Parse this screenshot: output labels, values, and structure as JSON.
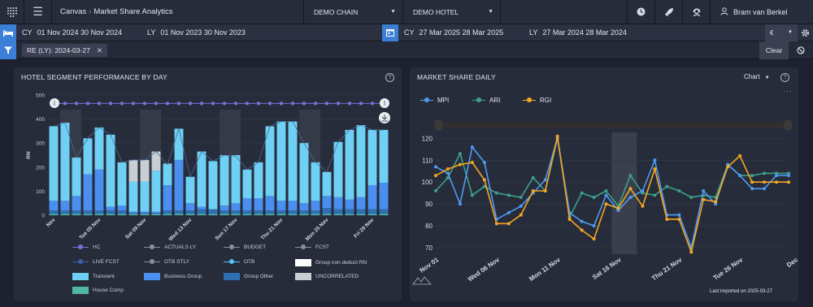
{
  "topbar": {
    "crumb_root": "Canvas",
    "crumb_page": "Market Share Analytics",
    "chain": "DEMO CHAIN",
    "hotel": "DEMO HOTEL",
    "user": "Bram van Berkel"
  },
  "dates": {
    "set1_cy_label": "CY",
    "set1_cy": "01 Nov 2024  30 Nov 2024",
    "set1_ly_label": "LY",
    "set1_ly": "01 Nov 2023  30 Nov 2023",
    "set2_cy_label": "CY",
    "set2_cy": "27 Mar 2025  28 Mar 2025",
    "set2_ly_label": "LY",
    "set2_ly": "27 Mar 2024  28 Mar 2024",
    "currency": "€"
  },
  "filters": {
    "chip": "RE (LY): 2024-03-27",
    "clear_label": "Clear"
  },
  "panel_left": {
    "title": "HOTEL SEGMENT PERFORMANCE BY DAY",
    "legend": [
      {
        "label": "HC",
        "kind": "line",
        "color": "#7b6fd6"
      },
      {
        "label": "ACTUALS LY",
        "kind": "line",
        "color": "#8a8f9c"
      },
      {
        "label": "BUDGET",
        "kind": "line",
        "color": "#8a8f9c"
      },
      {
        "label": "FCST",
        "kind": "line",
        "color": "#8a8f9c"
      },
      {
        "label": "LIVE FCST",
        "kind": "line",
        "color": "#3c5fa8"
      },
      {
        "label": "OTB STLY",
        "kind": "line",
        "color": "#8a8f9c"
      },
      {
        "label": "OTB",
        "kind": "line",
        "color": "#59c3f0"
      },
      {
        "label": "Group non deduct RN",
        "kind": "swatch",
        "color": "#ffffff"
      },
      {
        "label": "Transient",
        "kind": "swatch",
        "color": "#6fd0f5"
      },
      {
        "label": "Business Group",
        "kind": "swatch",
        "color": "#4a8ff0"
      },
      {
        "label": "Group Other",
        "kind": "swatch",
        "color": "#2f6fb0"
      },
      {
        "label": "UNCORRELATED",
        "kind": "swatch",
        "color": "#c9cdd4"
      },
      {
        "label": "House Comp",
        "kind": "swatch",
        "color": "#4fb8a5"
      }
    ]
  },
  "panel_right": {
    "title": "MARKET SHARE DAILY",
    "view_select": "Chart",
    "footer": "Last imported on 2025-03-27",
    "legend": [
      {
        "label": "MPI",
        "color": "#4d9bf0"
      },
      {
        "label": "ARI",
        "color": "#3fa08a"
      },
      {
        "label": "RGI",
        "color": "#f5a623"
      }
    ]
  },
  "chart_data": [
    {
      "type": "bar",
      "title": "HOTEL SEGMENT PERFORMANCE BY DAY",
      "ylabel": "RN",
      "ylim": [
        0,
        500
      ],
      "yticks": [
        0,
        100,
        200,
        300,
        400,
        500
      ],
      "categories": [
        "Nov",
        "2",
        "3",
        "4",
        "Tue 05 Nov",
        "6",
        "7",
        "8",
        "Sat 09 Nov",
        "10",
        "11",
        "12",
        "Wed 13 Nov",
        "14",
        "15",
        "16",
        "Sun 17 Nov",
        "18",
        "19",
        "20",
        "Thu 21 Nov",
        "22",
        "23",
        "24",
        "Mon 25 Nov",
        "26",
        "27",
        "28",
        "Fri 29 Nov",
        "30"
      ],
      "x_tick_labels": [
        "Nov",
        "Tue 05 Nov",
        "Sat 09 Nov",
        "Wed 13 Nov",
        "Sun 17 Nov",
        "Thu 21 Nov",
        "Mon 25 Nov",
        "Fri 29 Nov"
      ],
      "series": [
        {
          "name": "Transient",
          "values": [
            310,
            325,
            160,
            150,
            175,
            300,
            180,
            125,
            125,
            170,
            90,
            130,
            110,
            230,
            200,
            210,
            200,
            120,
            150,
            290,
            330,
            330,
            250,
            160,
            100,
            230,
            290,
            300,
            230,
            220
          ]
        },
        {
          "name": "Business Group",
          "values": [
            40,
            40,
            60,
            150,
            170,
            15,
            20,
            5,
            5,
            5,
            105,
            210,
            30,
            10,
            0,
            20,
            30,
            50,
            50,
            60,
            40,
            40,
            30,
            40,
            50,
            50,
            40,
            50,
            100,
            110
          ]
        },
        {
          "name": "Group Other",
          "values": [
            15,
            15,
            15,
            15,
            15,
            15,
            15,
            5,
            5,
            5,
            15,
            15,
            15,
            20,
            20,
            15,
            15,
            15,
            15,
            15,
            15,
            15,
            15,
            15,
            25,
            20,
            20,
            20,
            20,
            20
          ]
        },
        {
          "name": "UNCORRELATED",
          "values": [
            0,
            0,
            0,
            0,
            0,
            0,
            0,
            90,
            90,
            80,
            0,
            0,
            0,
            0,
            0,
            0,
            0,
            0,
            0,
            0,
            0,
            0,
            0,
            0,
            0,
            0,
            0,
            0,
            0,
            0
          ]
        },
        {
          "name": "House Comp",
          "values": [
            5,
            5,
            5,
            5,
            5,
            5,
            5,
            5,
            5,
            5,
            5,
            5,
            5,
            5,
            5,
            5,
            5,
            5,
            5,
            5,
            5,
            5,
            5,
            5,
            5,
            5,
            5,
            5,
            5,
            5
          ]
        },
        {
          "name": "HC",
          "values": [
            465,
            465,
            465,
            465,
            465,
            465,
            465,
            465,
            465,
            465,
            465,
            465,
            465,
            465,
            465,
            465,
            465,
            465,
            465,
            465,
            465,
            465,
            465,
            465,
            465,
            465,
            465,
            465,
            465,
            465
          ]
        },
        {
          "name": "OTB",
          "values": [
            370,
            385,
            240,
            320,
            365,
            335,
            220,
            230,
            230,
            265,
            210,
            360,
            160,
            265,
            225,
            250,
            245,
            190,
            220,
            370,
            390,
            390,
            300,
            220,
            180,
            305,
            355,
            375,
            355,
            355
          ]
        }
      ],
      "weekend_bands": [
        [
          1,
          2
        ],
        [
          8,
          9
        ],
        [
          15,
          16
        ],
        [
          22,
          23
        ]
      ]
    },
    {
      "type": "line",
      "title": "MARKET SHARE DAILY",
      "ylim": [
        67,
        122
      ],
      "yticks": [
        70,
        80,
        90,
        100,
        110,
        120
      ],
      "x": [
        1,
        2,
        3,
        4,
        5,
        6,
        7,
        8,
        9,
        10,
        11,
        12,
        13,
        14,
        15,
        16,
        17,
        18,
        19,
        20,
        21,
        22,
        23,
        24,
        25,
        26,
        27,
        28,
        29,
        30
      ],
      "x_tick_labels": [
        "Nov 01",
        "Wed 06 Nov",
        "Mon 11 Nov",
        "Sat 16 Nov",
        "Thu 21 Nov",
        "Tue 26 Nov",
        "Dec"
      ],
      "series": [
        {
          "name": "MPI",
          "values": [
            107,
            104,
            90,
            116,
            109,
            83,
            86,
            89,
            95,
            101,
            120,
            86,
            82,
            80,
            94,
            87,
            93,
            96,
            110,
            85,
            85,
            70,
            96,
            90,
            108,
            103,
            97,
            97,
            103,
            103
          ]
        },
        {
          "name": "ARI",
          "values": [
            96,
            102,
            113,
            94,
            98,
            95,
            94,
            93,
            102,
            96,
            120,
            84,
            95,
            93,
            96,
            89,
            103,
            95,
            94,
            98,
            96,
            93,
            94,
            93,
            108,
            103,
            103,
            104,
            104,
            104
          ]
        },
        {
          "name": "RGI",
          "values": [
            103,
            106,
            108,
            109,
            101,
            81,
            81,
            85,
            96,
            96,
            121,
            83,
            78,
            74,
            90,
            88,
            97,
            89,
            106,
            83,
            83,
            68,
            92,
            91,
            107,
            112,
            100,
            100,
            100,
            100
          ]
        }
      ],
      "weekend_band": [
        16,
        17
      ]
    }
  ]
}
